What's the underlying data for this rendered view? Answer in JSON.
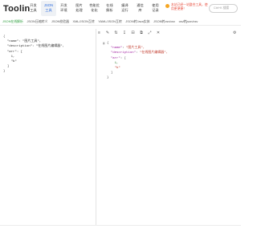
{
  "header": {
    "logo": "Toolin",
    "nav": [
      {
        "line1": "开发",
        "line2": "工具"
      },
      {
        "line1": "JSON",
        "line2": "工具"
      },
      {
        "line1": "开发",
        "line2": "环境"
      },
      {
        "line1": "图片",
        "line2": "处理"
      },
      {
        "line1": "性能优",
        "line2": "化化"
      },
      {
        "line1": "在线",
        "line2": "解析"
      },
      {
        "line1": "编译",
        "line2": "运行"
      },
      {
        "line1": "通信",
        "line2": "库"
      },
      {
        "line1": "使用",
        "line2": "记录"
      }
    ],
    "notice": "本站已经一站整合工具，使用更便捷！",
    "search_placeholder": "Ctrl+K 搜索"
  },
  "tabs": [
    {
      "label": "JSON在线解析",
      "active": true
    },
    {
      "label": "JSON压缩转义",
      "active": false
    },
    {
      "label": "JSON校验器",
      "active": false
    },
    {
      "label": "XML/JSON互转",
      "active": false
    },
    {
      "label": "YAML/JSON互转",
      "active": false
    },
    {
      "label": "JSON转Java实体",
      "active": false
    },
    {
      "label": "JSON转csv/csv",
      "active": false
    },
    {
      "label": "csv转json/csv",
      "active": false
    }
  ],
  "toolbar": {
    "icons": [
      "format-icon",
      "edit-icon",
      "sort-icon",
      "sort-desc-icon",
      "collapse-icon",
      "copy-icon",
      "expand-icon",
      "close-icon"
    ],
    "right_icon": "settings-icon"
  },
  "left_code": [
    {
      "indent": 0,
      "text": "{"
    },
    {
      "indent": 1,
      "text": "\"name\": \"图片工具\","
    },
    {
      "indent": 1,
      "text": "\"description\": \"在线图片编辑器\","
    },
    {
      "indent": 1,
      "text": "\"arr\": ["
    },
    {
      "indent": 2,
      "text": "1,"
    },
    {
      "indent": 2,
      "text": "\"b\""
    },
    {
      "indent": 1,
      "text": "]"
    },
    {
      "indent": 0,
      "text": "}"
    }
  ],
  "right_code": [
    {
      "indent": 0,
      "text": "{"
    },
    {
      "indent": 1,
      "key": "\"name\"",
      "value": "\"图片工具\","
    },
    {
      "indent": 1,
      "key": "\"description\"",
      "value": "\"在线图片编辑器\","
    },
    {
      "indent": 1,
      "key": "\"arr\"",
      "value": "["
    },
    {
      "indent": 2,
      "text": "1,"
    },
    {
      "indent": 2,
      "text": "\"b\""
    },
    {
      "indent": 1,
      "text": "]"
    },
    {
      "indent": 0,
      "text": "}"
    }
  ]
}
